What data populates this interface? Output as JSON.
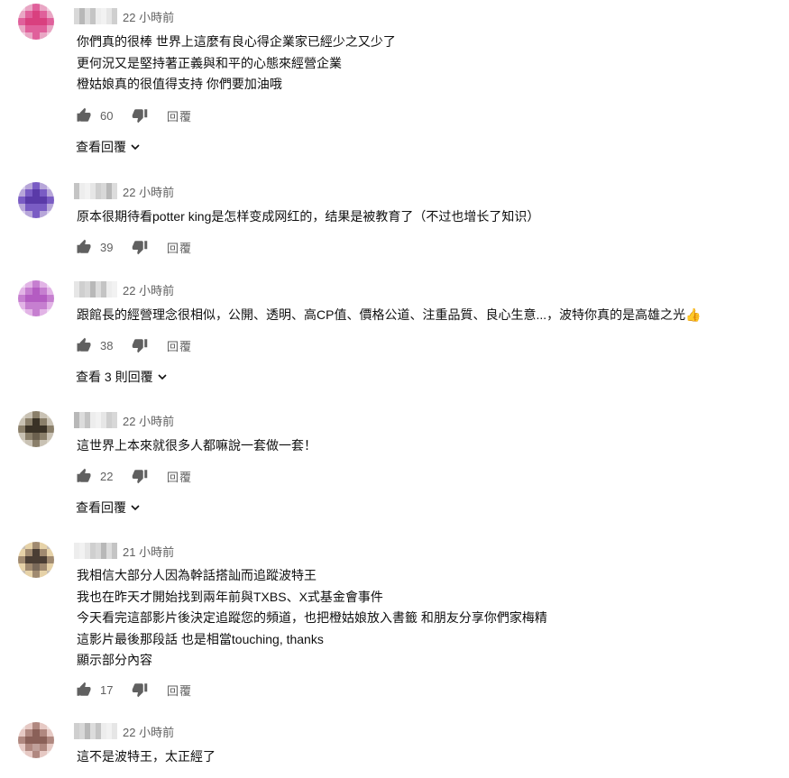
{
  "comments": [
    {
      "time": "22 小時前",
      "avatar_colors": [
        "#e9a6c4",
        "#e0609b",
        "#d9407f",
        "#e0609b",
        "#f3cde0"
      ],
      "lines": [
        "你們真的很棒 世界上這麼有良心得企業家已經少之又少了",
        "更何況又是堅持著正義與和平的心態來經營企業",
        "橙姑娘真的很值得支持 你們要加油哦"
      ],
      "likes": "60",
      "reply_label": "回覆",
      "view_replies": "查看回覆"
    },
    {
      "time": "22 小時前",
      "avatar_colors": [
        "#b7a6d9",
        "#7a5cc4",
        "#5a3aa8",
        "#7a5cc4",
        "#d8cdee"
      ],
      "lines": [
        "原本很期待看potter king是怎样变成网红的，结果是被教育了（不过也增长了知识）"
      ],
      "likes": "39",
      "reply_label": "回覆",
      "view_replies": ""
    },
    {
      "time": "22 小時前",
      "avatar_colors": [
        "#e2b4e6",
        "#c67fd0",
        "#b45cc2",
        "#c67fd0",
        "#f0d9f3"
      ],
      "lines": [
        "跟館長的經營理念很相似，公開、透明、高CP值、價格公道、注重品質、良心生意...，波特你真的是高雄之光"
      ],
      "emoji": "👍",
      "likes": "38",
      "reply_label": "回覆",
      "view_replies": "查看 3 則回覆"
    },
    {
      "time": "22 小時前",
      "avatar_colors": [
        "#c9c2b4",
        "#8a7f6a",
        "#3a3226",
        "#6b604e",
        "#d9d3c6"
      ],
      "lines": [
        "這世界上本來就很多人都嘛說一套做一套！"
      ],
      "likes": "22",
      "reply_label": "回覆",
      "view_replies": "查看回覆"
    },
    {
      "time": "21 小時前",
      "avatar_colors": [
        "#e6d2a8",
        "#a08a70",
        "#4a3e34",
        "#7a6a5a",
        "#c9bfb2"
      ],
      "lines": [
        "我相信大部分人因為幹話搭訕而追蹤波特王",
        "我也在昨天才開始找到兩年前與TXBS、X式基金會事件",
        "今天看完這部影片後決定追蹤您的頻道，也把橙姑娘放入書籤 和朋友分享你們家梅精",
        "這影片最後那段話 也是相當touching, thanks",
        "顯示部分內容"
      ],
      "likes": "17",
      "reply_label": "回覆",
      "view_replies": ""
    },
    {
      "time": "22 小時前",
      "avatar_colors": [
        "#e6c9c4",
        "#b08880",
        "#8a6058",
        "#c0a09a",
        "#efe0dd"
      ],
      "lines": [
        "這不是波特王，太正經了"
      ],
      "likes": "",
      "reply_label": "",
      "view_replies": ""
    }
  ]
}
